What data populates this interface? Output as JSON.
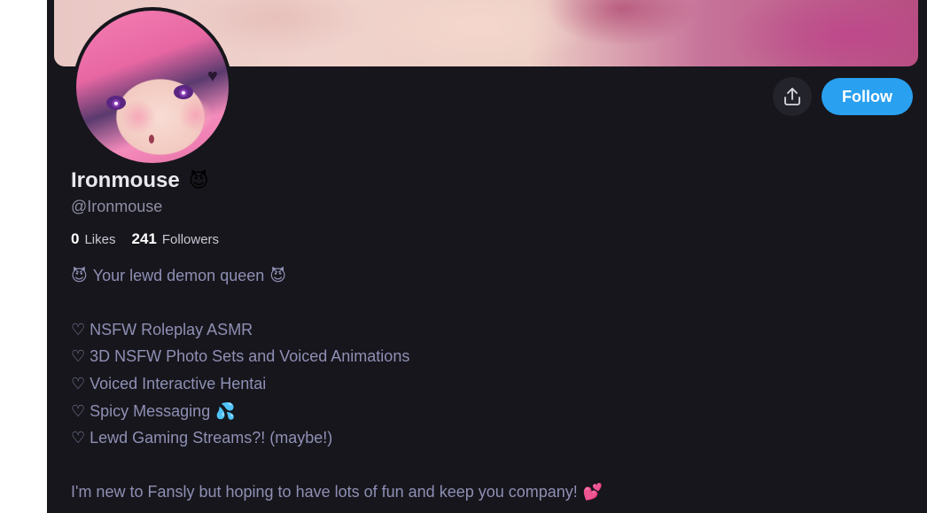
{
  "profile": {
    "display_name": "Ironmouse",
    "name_emoji": "😈",
    "handle": "@Ironmouse",
    "follow_label": "Follow",
    "share_icon": "share-icon"
  },
  "stats": {
    "likes_count": "0",
    "likes_label": "Likes",
    "followers_count": "241",
    "followers_label": "Followers"
  },
  "bio": {
    "line1_prefix": "😈",
    "line1_text": "Your lewd demon queen",
    "line1_suffix": "😈",
    "items": [
      "♡ NSFW Roleplay ASMR",
      "♡ 3D NSFW Photo Sets and Voiced Animations",
      "♡ Voiced Interactive Hentai",
      "♡ Spicy Messaging",
      "♡ Lewd Gaming Streams?! (maybe!)"
    ],
    "spicy_emoji": "💦",
    "closing_text": "I'm new to Fansly but hoping to have lots of fun and keep you company!",
    "closing_emoji": "💕"
  },
  "colors": {
    "background": "#16161c",
    "accent": "#2aa0f0",
    "bio_text": "#8f8fb5"
  }
}
